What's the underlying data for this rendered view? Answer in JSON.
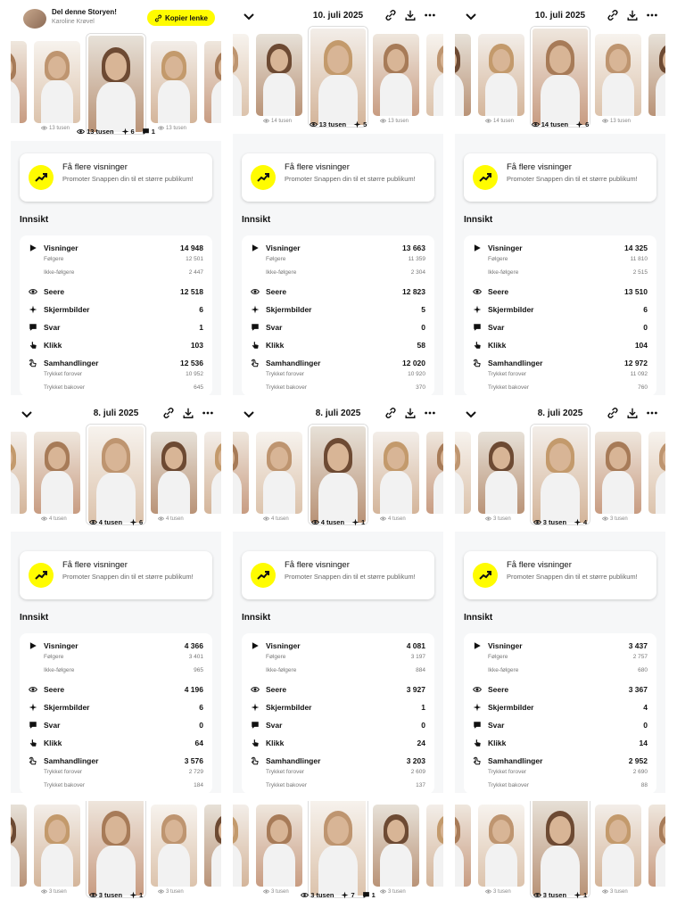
{
  "share": {
    "title": "Del denne Storyen!",
    "name": "Karoline Krøvel",
    "copy_label": "Kopier lenke"
  },
  "promo": {
    "title": "Få flere visninger",
    "subtitle": "Promoter Snappen din til et større publikum!"
  },
  "innsikt_label": "Innsikt",
  "labels": {
    "visninger": "Visninger",
    "folgere": "Følgere",
    "ikke_folgere": "Ikke-følgere",
    "seere": "Seere",
    "skjermbilder": "Skjermbilder",
    "svar": "Svar",
    "klikk": "Klikk",
    "samhandlinger": "Samhandlinger",
    "trykket_forover": "Trykket forover",
    "trykket_bakover": "Trykket bakover"
  },
  "panels": [
    {
      "header_type": "share",
      "date": "",
      "thumb_labels": [
        "",
        "13 tusen",
        "",
        "13 tusen"
      ],
      "center": {
        "views": "13 tusen",
        "screens": "6",
        "replies": "1"
      },
      "stats": {
        "visninger": "14 948",
        "folgere": "12 501",
        "ikke_folgere": "2 447",
        "seere": "12 518",
        "skjermbilder": "6",
        "svar": "1",
        "klikk": "103",
        "samhandlinger": "12 536",
        "trykket_forover": "10 952",
        "trykket_bakover": "645"
      }
    },
    {
      "header_type": "date",
      "date": "10. juli 2025",
      "thumb_labels": [
        "",
        "14 tusen",
        "",
        "13 tusen"
      ],
      "center": {
        "views": "13 tusen",
        "screens": "5",
        "replies": ""
      },
      "stats": {
        "visninger": "13 663",
        "folgere": "11 359",
        "ikke_folgere": "2 304",
        "seere": "12 823",
        "skjermbilder": "5",
        "svar": "0",
        "klikk": "58",
        "samhandlinger": "12 020",
        "trykket_forover": "10 920",
        "trykket_bakover": "370"
      }
    },
    {
      "header_type": "date",
      "date": "10. juli 2025",
      "thumb_labels": [
        "",
        "14 tusen",
        "",
        "13 tusen"
      ],
      "center": {
        "views": "14 tusen",
        "screens": "6",
        "replies": ""
      },
      "stats": {
        "visninger": "14 325",
        "folgere": "11 810",
        "ikke_folgere": "2 515",
        "seere": "13 510",
        "skjermbilder": "6",
        "svar": "0",
        "klikk": "104",
        "samhandlinger": "12 972",
        "trykket_forover": "11 092",
        "trykket_bakover": "760"
      }
    },
    {
      "header_type": "date",
      "date": "8. juli 2025",
      "thumb_labels": [
        "",
        "4 tusen",
        "",
        "4 tusen"
      ],
      "center": {
        "views": "4 tusen",
        "screens": "6",
        "replies": ""
      },
      "stats": {
        "visninger": "4 366",
        "folgere": "3 401",
        "ikke_folgere": "965",
        "seere": "4 196",
        "skjermbilder": "6",
        "svar": "0",
        "klikk": "64",
        "samhandlinger": "3 576",
        "trykket_forover": "2 729",
        "trykket_bakover": "184"
      }
    },
    {
      "header_type": "date",
      "date": "8. juli 2025",
      "thumb_labels": [
        "",
        "4 tusen",
        "",
        "4 tusen"
      ],
      "center": {
        "views": "4 tusen",
        "screens": "1",
        "replies": ""
      },
      "stats": {
        "visninger": "4 081",
        "folgere": "3 197",
        "ikke_folgere": "884",
        "seere": "3 927",
        "skjermbilder": "1",
        "svar": "0",
        "klikk": "24",
        "samhandlinger": "3 203",
        "trykket_forover": "2 609",
        "trykket_bakover": "137"
      }
    },
    {
      "header_type": "date",
      "date": "8. juli 2025",
      "thumb_labels": [
        "",
        "3 tusen",
        "",
        "3 tusen"
      ],
      "center": {
        "views": "3 tusen",
        "screens": "4",
        "replies": ""
      },
      "stats": {
        "visninger": "3 437",
        "folgere": "2 757",
        "ikke_folgere": "680",
        "seere": "3 367",
        "skjermbilder": "4",
        "svar": "0",
        "klikk": "14",
        "samhandlinger": "2 952",
        "trykket_forover": "2 690",
        "trykket_bakover": "88"
      }
    }
  ],
  "bottom_panels": [
    {
      "thumb_labels": [
        "3 tusen",
        "3 tusen"
      ],
      "center": {
        "views": "3 tusen",
        "screens": "1",
        "replies": ""
      }
    },
    {
      "thumb_labels": [
        "3 tusen",
        "3 tusen"
      ],
      "center": {
        "views": "3 tusen",
        "screens": "7",
        "replies": "1"
      }
    },
    {
      "thumb_labels": [
        "3 tusen",
        "3 tusen"
      ],
      "center": {
        "views": "3 tusen",
        "screens": "1",
        "replies": ""
      }
    }
  ],
  "colors": {
    "accent_yellow": "#fffc00",
    "panel_bg": "#f6f7f8"
  },
  "icons": [
    "chevron-down-icon",
    "link-icon",
    "download-icon",
    "more-icon",
    "eye-icon",
    "screenshot-icon",
    "reply-icon",
    "play-icon",
    "click-icon",
    "interaction-icon",
    "trend-up-icon"
  ]
}
